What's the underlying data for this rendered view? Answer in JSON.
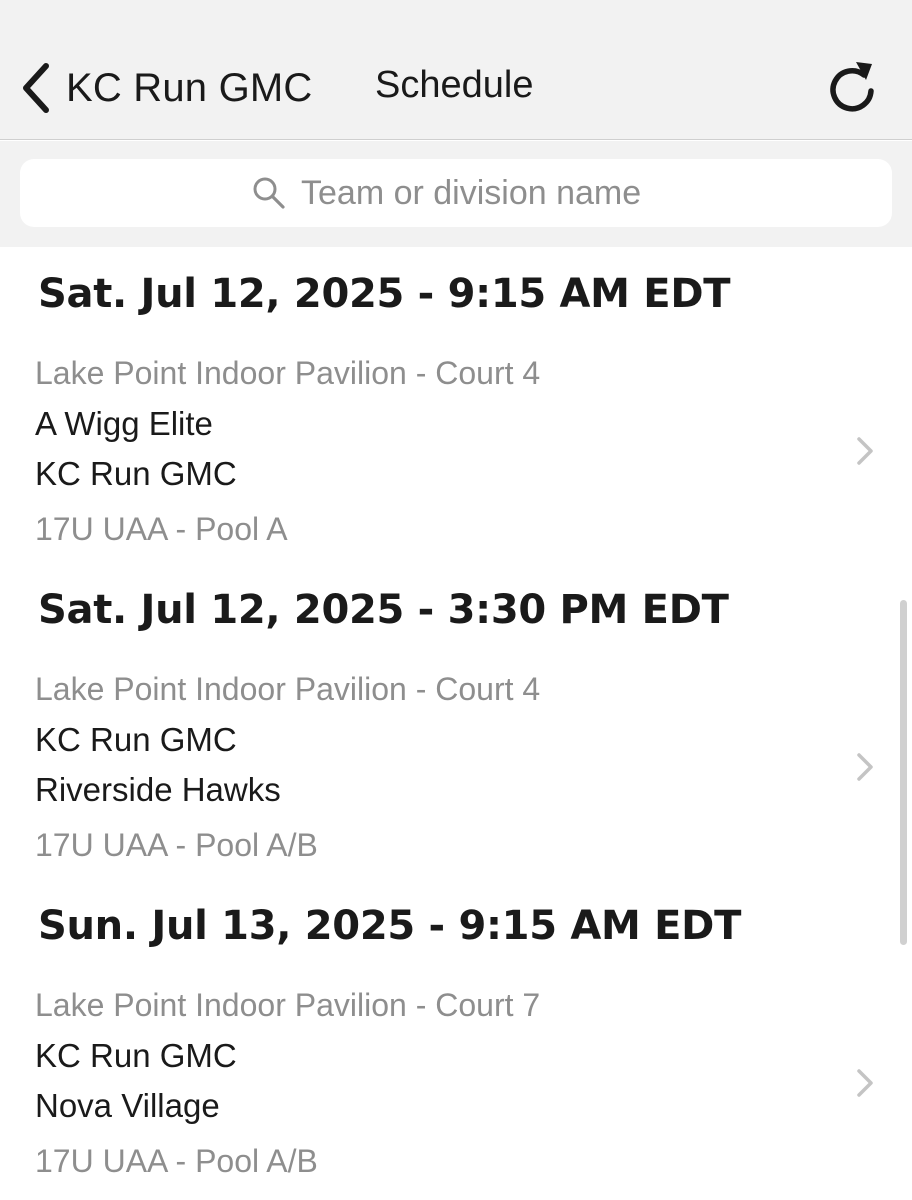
{
  "nav": {
    "back_label": "KC Run GMC",
    "title": "Schedule"
  },
  "search": {
    "placeholder": "Team or division name",
    "value": ""
  },
  "games": [
    {
      "date": "Sat. Jul 12, 2025 - 9:15 AM EDT",
      "venue": "Lake Point Indoor Pavilion - Court 4",
      "team1": "A Wigg Elite",
      "team2": "KC Run GMC",
      "division": "17U UAA - Pool A"
    },
    {
      "date": "Sat. Jul 12, 2025 - 3:30 PM EDT",
      "venue": "Lake Point Indoor Pavilion - Court 4",
      "team1": "KC Run GMC",
      "team2": "Riverside Hawks",
      "division": "17U UAA - Pool A/B"
    },
    {
      "date": "Sun. Jul 13, 2025 - 9:15 AM EDT",
      "venue": "Lake Point Indoor Pavilion - Court 7",
      "team1": "KC Run GMC",
      "team2": "Nova Village",
      "division": "17U UAA - Pool A/B"
    }
  ],
  "icons": {
    "back": "chevron-left-icon",
    "refresh": "refresh-icon",
    "search": "search-icon",
    "disclosure": "chevron-right-icon"
  },
  "colors": {
    "nav_background": "#f2f2f2",
    "primary_text": "#1a1a1a",
    "secondary_text": "#8e8e8e",
    "chevron": "#c4c4c4"
  }
}
